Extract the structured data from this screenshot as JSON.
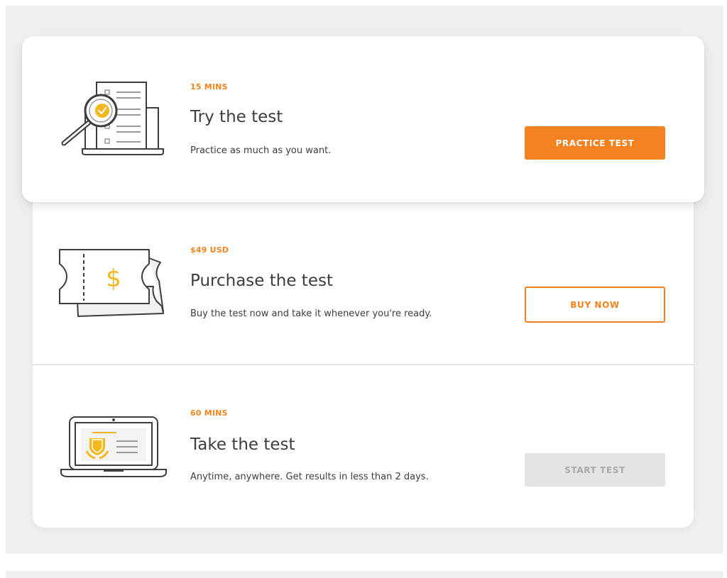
{
  "steps": [
    {
      "id": "try",
      "kicker": "15 MINS",
      "title": "Try the test",
      "description": "Practice as much as you want.",
      "button_label": "PRACTICE TEST",
      "button_state": "primary",
      "icon": "document-magnifier-icon"
    },
    {
      "id": "purchase",
      "kicker": "$49 USD",
      "title": "Purchase the test",
      "description": "Buy the test now and take it whenever you're ready.",
      "button_label": "BUY NOW",
      "button_state": "outline",
      "icon": "ticket-dollar-icon"
    },
    {
      "id": "take",
      "kicker": "60 MINS",
      "title": "Take the test",
      "description": "Anytime, anywhere. Get results in less than 2 days.",
      "button_label": "START TEST",
      "button_state": "disabled",
      "icon": "laptop-certificate-icon"
    }
  ],
  "colors": {
    "accent": "#f58220",
    "text": "#3d3d3d",
    "disabled_bg": "#e4e4e4",
    "disabled_text": "#a9a9a9",
    "icon_yellow": "#f5b81c"
  }
}
